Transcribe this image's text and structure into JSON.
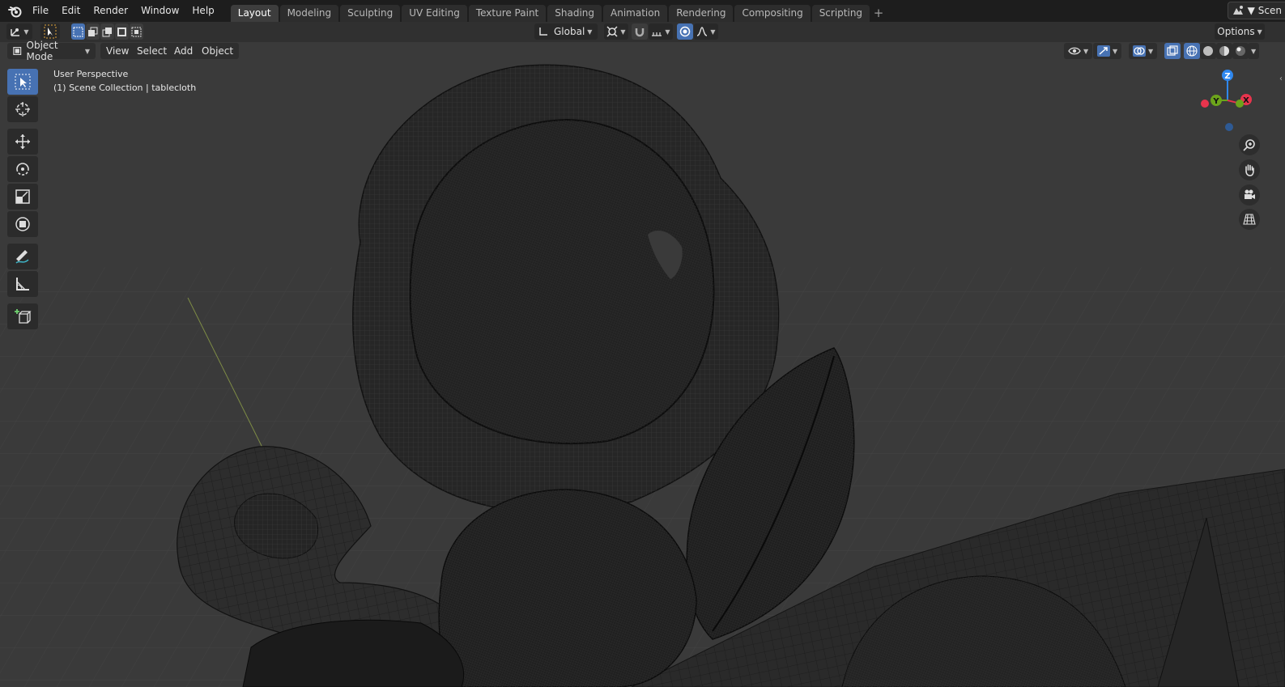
{
  "menu": {
    "items": [
      "File",
      "Edit",
      "Render",
      "Window",
      "Help"
    ]
  },
  "workspaces": {
    "tabs": [
      "Layout",
      "Modeling",
      "Sculpting",
      "UV Editing",
      "Texture Paint",
      "Shading",
      "Animation",
      "Rendering",
      "Compositing",
      "Scripting"
    ],
    "active": "Layout",
    "add_label": "+"
  },
  "scene": {
    "name": "Scen"
  },
  "tool_header": {
    "orientation": "Global",
    "options_label": "Options"
  },
  "viewport_header": {
    "mode": "Object Mode",
    "menus": [
      "View",
      "Select",
      "Add",
      "Object"
    ]
  },
  "viewport": {
    "perspective": "User Perspective",
    "collection": "(1) Scene Collection | tablecloth"
  },
  "gizmo": {
    "axes": [
      "Z",
      "Y",
      "X"
    ],
    "colors": {
      "x": "#e8344d",
      "y": "#6ca41b",
      "z": "#2f88ef"
    }
  },
  "toolbar": {
    "tools": [
      "select-box",
      "cursor",
      "move",
      "rotate",
      "scale",
      "transform",
      "annotate",
      "measure",
      "add-cube"
    ],
    "active": "select-box"
  },
  "colors": {
    "accent": "#4772b3",
    "topbar": "#1d1d1d",
    "header": "#303030",
    "viewport_bg": "#3a3a3a"
  }
}
